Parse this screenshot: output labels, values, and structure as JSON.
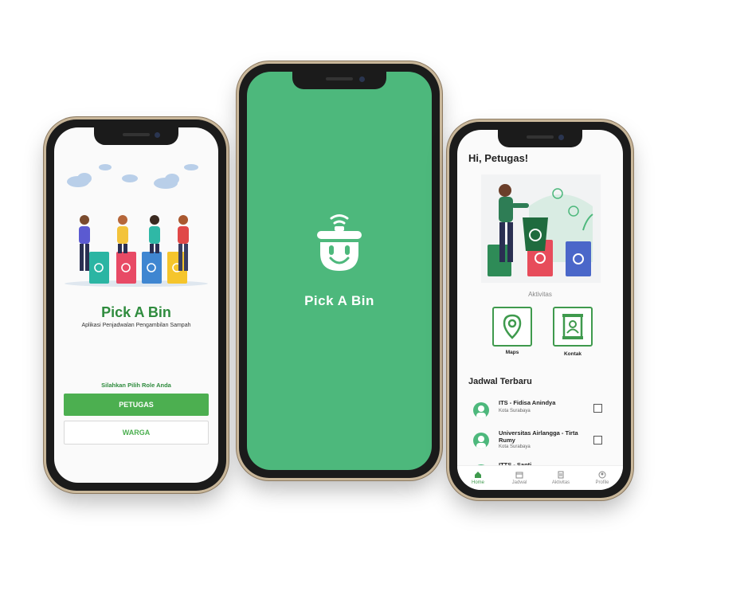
{
  "login": {
    "title": "Pick A Bin",
    "subtitle": "Aplikasi Penjadwalan Pengambilan Sampah",
    "role_prompt": "Silahkan Pilih Role Anda",
    "btn_petugas": "PETUGAS",
    "btn_warga": "WARGA"
  },
  "splash": {
    "app_name": "Pick A Bin"
  },
  "home": {
    "greeting": "Hi, Petugas!",
    "activities_label": "Aktivitas",
    "maps_label": "Maps",
    "kontak_label": "Kontak",
    "schedule_title": "Jadwal Terbaru",
    "schedule": [
      {
        "name": "ITS - Fidisa Anindya",
        "city": "Kota Surabaya"
      },
      {
        "name": "Universitas Airlangga - Tirta Rumy",
        "city": "Kota Surabaya"
      },
      {
        "name": "ITTS - Santi",
        "city": ""
      }
    ],
    "nav": [
      {
        "label": "Home",
        "icon": "home-icon",
        "active": true
      },
      {
        "label": "Jadwal",
        "icon": "calendar-icon",
        "active": false
      },
      {
        "label": "Aktivitas",
        "icon": "list-icon",
        "active": false
      },
      {
        "label": "Profile",
        "icon": "profile-icon",
        "active": false
      }
    ]
  },
  "colors": {
    "brand_green": "#4db87c",
    "button_green": "#4caf50",
    "title_green": "#2e8b3d"
  }
}
